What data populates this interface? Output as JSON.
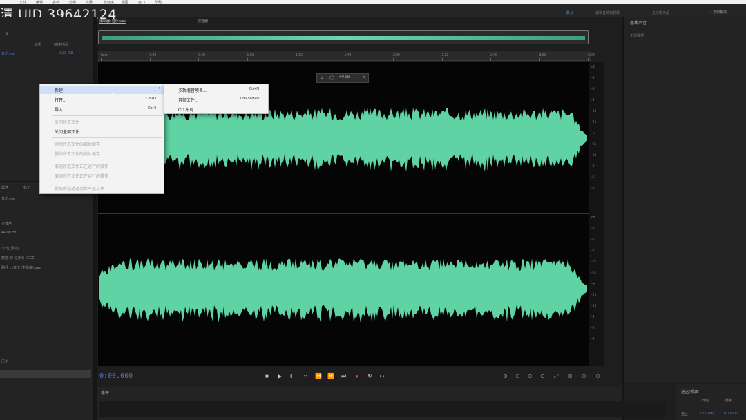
{
  "watermark": "UID 39642124",
  "watermark_prefix": "清",
  "menubar": [
    "文件",
    "编辑",
    "多轨",
    "剪辑",
    "效果",
    "收藏夹",
    "视图",
    "窗口",
    "帮助"
  ],
  "workspace": {
    "items": [
      "默认",
      "编辑音频到视频",
      "无线电作品"
    ],
    "search_label": "搜索帮助"
  },
  "file_panel": {
    "tool_icon": "search-icon",
    "col_status": "状态",
    "col_duration": "持续时间",
    "row_name": "音乐.wav",
    "row_duration": "3:30.458"
  },
  "info_panel": {
    "tab1": "属性",
    "tab2": "标记",
    "file": "音乐.wav",
    "lines": [
      "立体声",
      "44100 Hz",
      "32 位(浮点)",
      "数据 32 位浮点 (IEEE)",
      "路径 ...\\音乐 (主题曲).wav"
    ]
  },
  "bottom_left": {
    "title": "历史"
  },
  "editor_tabs": {
    "active": "编辑器: 音乐.wav",
    "mixer": "混音器"
  },
  "ruler": {
    "labels": [
      "hms",
      "0:20",
      "0:40",
      "1:00",
      "1:20",
      "1:40",
      "2:00",
      "2:20",
      "2:40",
      "3:00",
      "3:20"
    ]
  },
  "mini_toolbar": {
    "gain": "+0 dB"
  },
  "db_scale": {
    "ch1": [
      "dB",
      "-3",
      "-6",
      "-9",
      "-15",
      "-21",
      "-∞",
      "-21",
      "-15",
      "-9",
      "-6",
      "-3"
    ],
    "ch2": [
      "dB",
      "-3",
      "-6",
      "-9",
      "-15",
      "-21",
      "-∞",
      "-21",
      "-15",
      "-9",
      "-6",
      "-3"
    ]
  },
  "transport": {
    "timecode": "0:00.000",
    "buttons": [
      "stop",
      "play",
      "pause",
      "to-start",
      "rewind",
      "fast-forward",
      "to-end",
      "record",
      "loop",
      "skip"
    ],
    "zoom": [
      "zoom-in-amplitude",
      "zoom-out-amplitude",
      "zoom-in-time",
      "zoom-out-time",
      "zoom-full",
      "zoom-in-left",
      "zoom-in-right",
      "zoom-selection"
    ]
  },
  "levels": {
    "title": "电平"
  },
  "right_panel": {
    "title": "基本声音",
    "subtitle": "无选择项"
  },
  "selection_view": {
    "title": "选区/视图",
    "col_start": "开始",
    "col_end": "结束",
    "row_label": "选区",
    "start": "0:00.000",
    "end": "0:00.000"
  },
  "context_menu": {
    "items": [
      {
        "label": "新建",
        "shortcut": "",
        "enabled": true,
        "highlight": true,
        "submenu": true
      },
      {
        "label": "打开...",
        "shortcut": "Ctrl+O",
        "enabled": true
      },
      {
        "label": "导入...",
        "shortcut": "Ctrl+I",
        "enabled": true
      },
      {
        "label": "关闭所选文件",
        "shortcut": "",
        "enabled": false
      },
      {
        "label": "关闭全部文件",
        "shortcut": "",
        "enabled": true
      },
      {
        "label": "删除所选文件的媒体缓存",
        "shortcut": "",
        "enabled": false
      },
      {
        "label": "删除所有文件的媒体缓存",
        "shortcut": "",
        "enabled": false
      },
      {
        "label": "取消所选文件正在运行的操作",
        "shortcut": "",
        "enabled": false
      },
      {
        "label": "取消所有文件正在运行的操作",
        "shortcut": "",
        "enabled": false
      },
      {
        "label": "提取所选通道到单声道文件",
        "shortcut": "",
        "enabled": false
      }
    ]
  },
  "sub_menu": {
    "items": [
      {
        "label": "多轨混音项目...",
        "shortcut": "Ctrl+N"
      },
      {
        "label": "音频文件...",
        "shortcut": "Ctrl+Shift+N"
      },
      {
        "label": "CD 布局",
        "shortcut": ""
      }
    ]
  },
  "colors": {
    "waveform": "#5fd3a3",
    "accent": "#4b79c8",
    "background": "#050505"
  }
}
